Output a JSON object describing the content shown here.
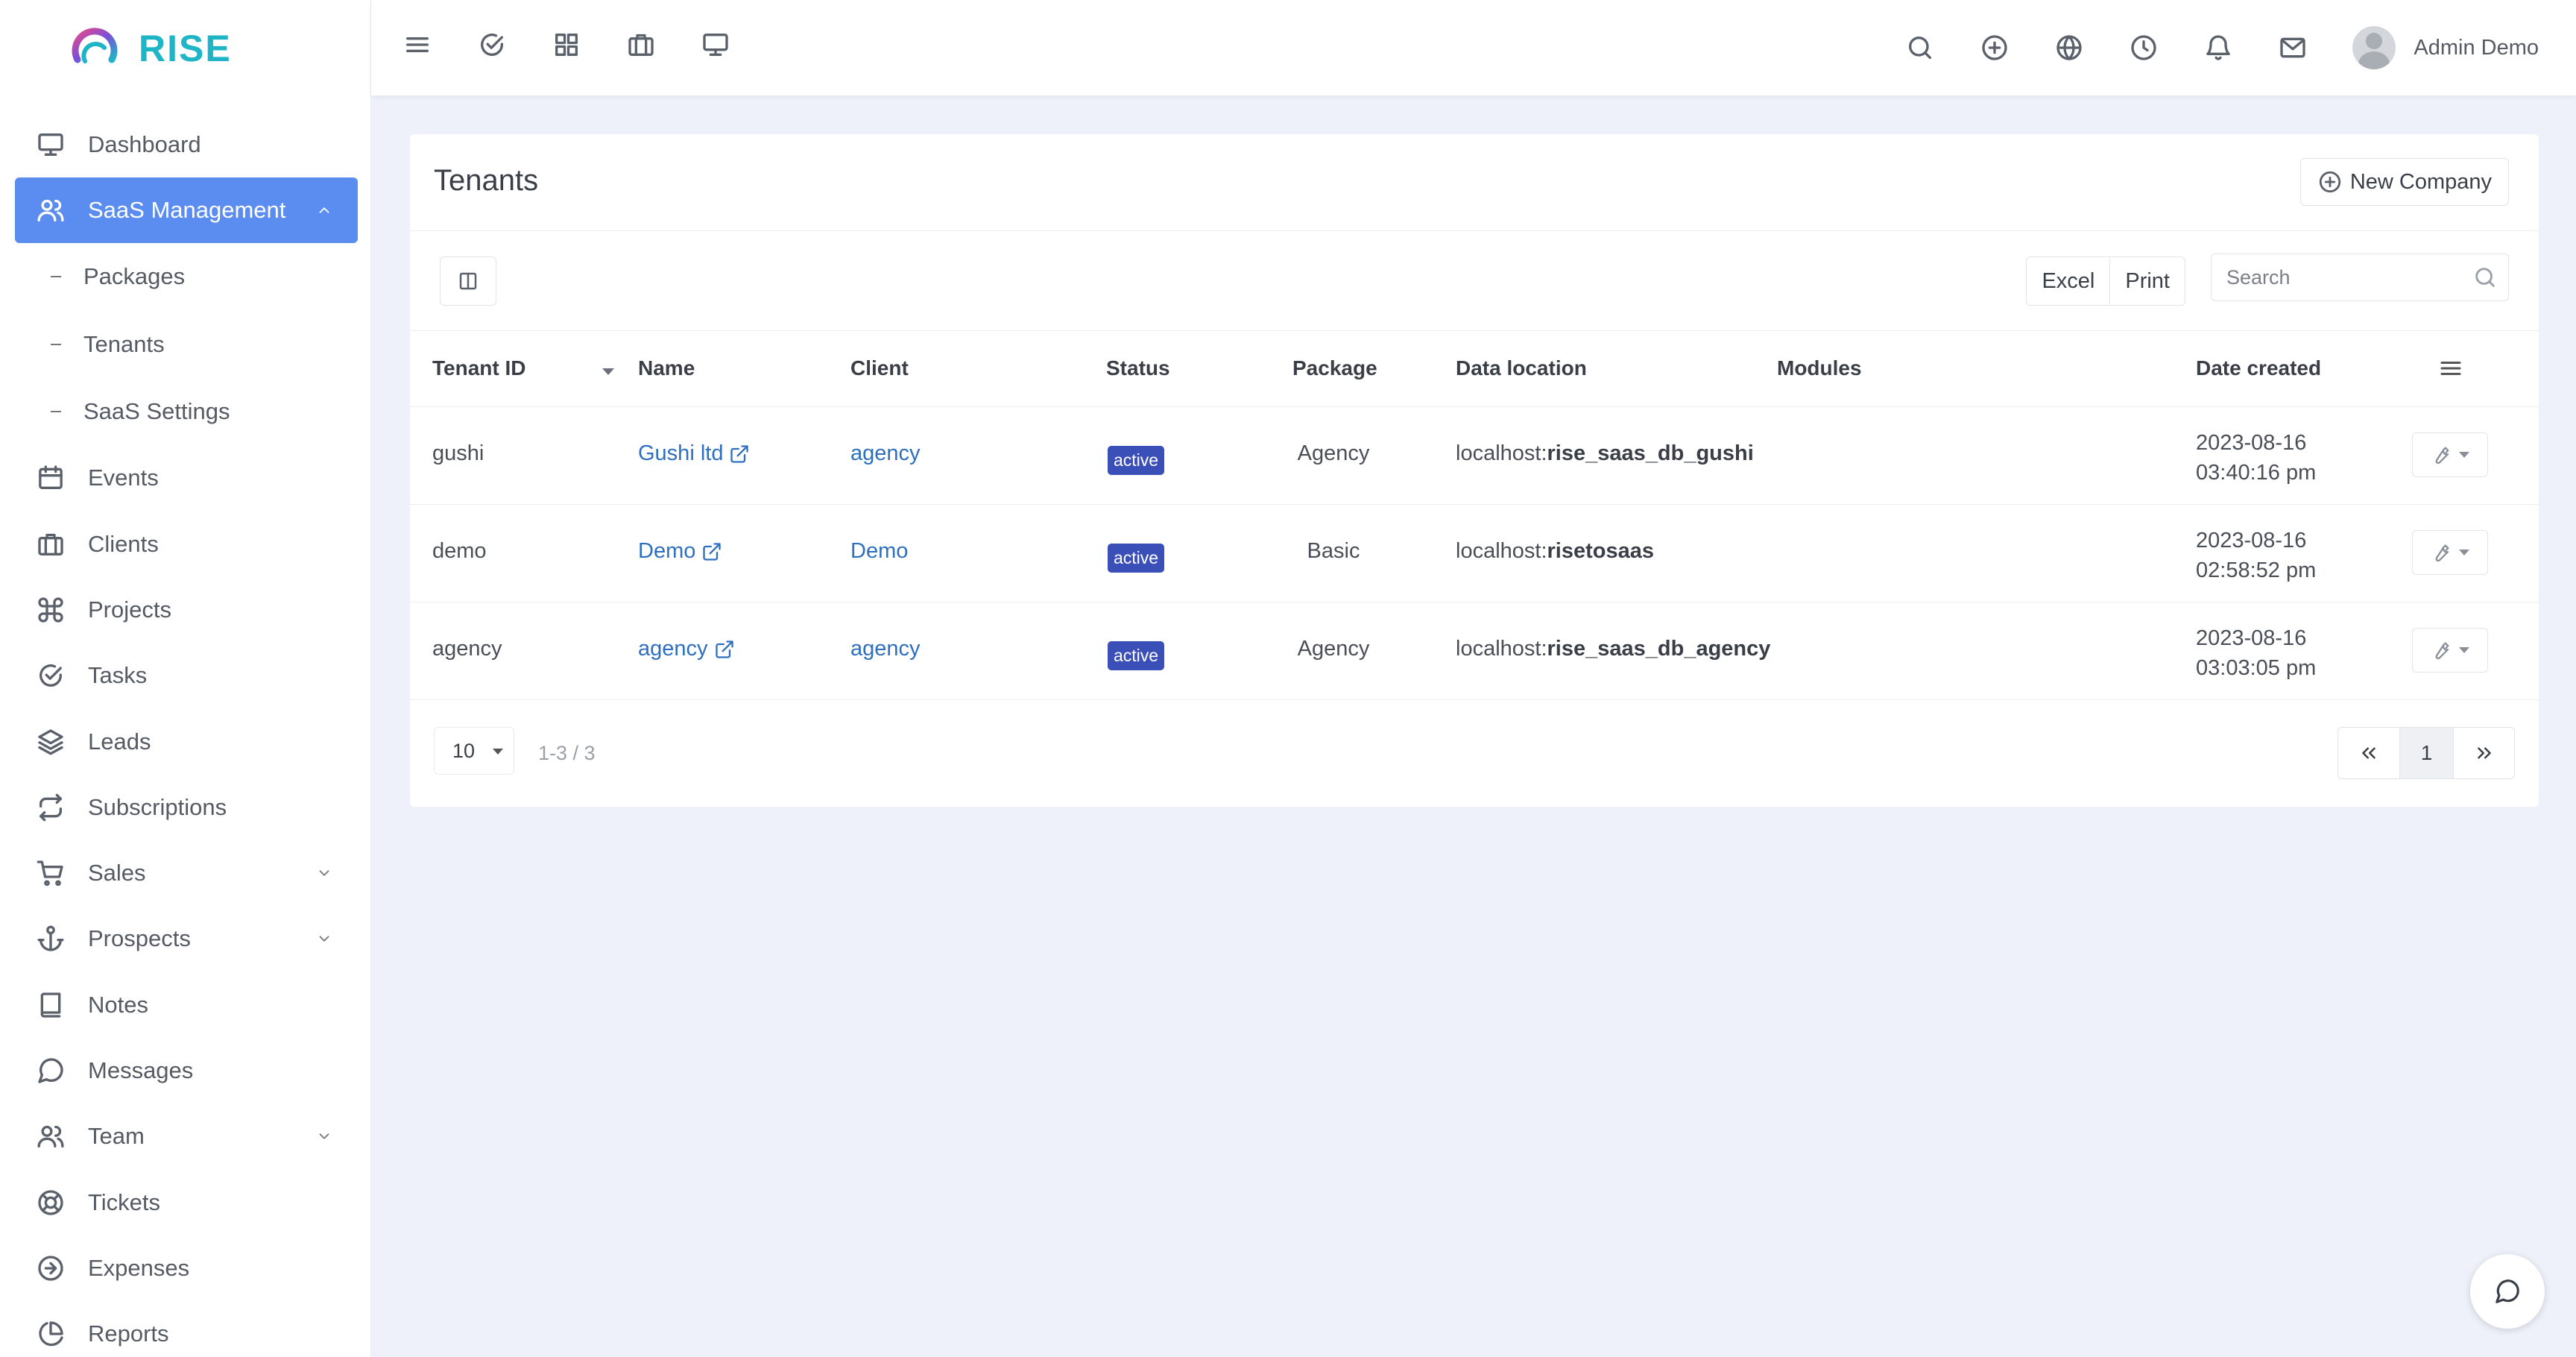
{
  "brand": {
    "name": "RISE"
  },
  "sidebar": {
    "items": [
      {
        "label": "Dashboard"
      },
      {
        "label": "SaaS Management"
      },
      {
        "label": "Packages"
      },
      {
        "label": "Tenants"
      },
      {
        "label": "SaaS Settings"
      },
      {
        "label": "Events"
      },
      {
        "label": "Clients"
      },
      {
        "label": "Projects"
      },
      {
        "label": "Tasks"
      },
      {
        "label": "Leads"
      },
      {
        "label": "Subscriptions"
      },
      {
        "label": "Sales"
      },
      {
        "label": "Prospects"
      },
      {
        "label": "Notes"
      },
      {
        "label": "Messages"
      },
      {
        "label": "Team"
      },
      {
        "label": "Tickets"
      },
      {
        "label": "Expenses"
      },
      {
        "label": "Reports"
      }
    ],
    "active_item": "SaaS Management",
    "accent_color": "#5b8df0"
  },
  "topbar": {
    "left_icons": [
      "menu-icon",
      "check-circle-icon",
      "grid-icon",
      "briefcase-icon",
      "monitor-icon"
    ],
    "right_icons": [
      "search-icon",
      "plus-circle-icon",
      "globe-icon",
      "clock-icon",
      "bell-icon",
      "mail-icon"
    ],
    "user_name": "Admin Demo"
  },
  "page": {
    "title": "Tenants",
    "new_button": "New Company",
    "excel": "Excel",
    "print": "Print",
    "search_placeholder": "Search"
  },
  "table": {
    "columns": {
      "tenant_id": "Tenant ID",
      "name": "Name",
      "client": "Client",
      "status": "Status",
      "package": "Package",
      "data_location": "Data location",
      "modules": "Modules",
      "date_created": "Date created"
    },
    "rows": [
      {
        "tenant_id": "gushi",
        "name": "Gushi ltd",
        "client": "agency",
        "status": "active",
        "package": "Agency",
        "loc_host": "localhost:",
        "loc_db": "rise_saas_db_gushi",
        "date": "2023-08-16",
        "time": "03:40:16 pm"
      },
      {
        "tenant_id": "demo",
        "name": "Demo",
        "client": "Demo",
        "status": "active",
        "package": "Basic",
        "loc_host": "localhost:",
        "loc_db": "risetosaas",
        "date": "2023-08-16",
        "time": "02:58:52 pm"
      },
      {
        "tenant_id": "agency",
        "name": "agency",
        "client": "agency",
        "status": "active",
        "package": "Agency",
        "loc_host": "localhost:",
        "loc_db": "rise_saas_db_agency",
        "date": "2023-08-16",
        "time": "03:03:05 pm"
      }
    ]
  },
  "footer": {
    "page_size": "10",
    "range": "1-3 / 3",
    "current_page": "1"
  },
  "colors": {
    "status_badge": "#3b4fb8",
    "link": "#2f6fbf",
    "brand": "#1fb5c7"
  }
}
